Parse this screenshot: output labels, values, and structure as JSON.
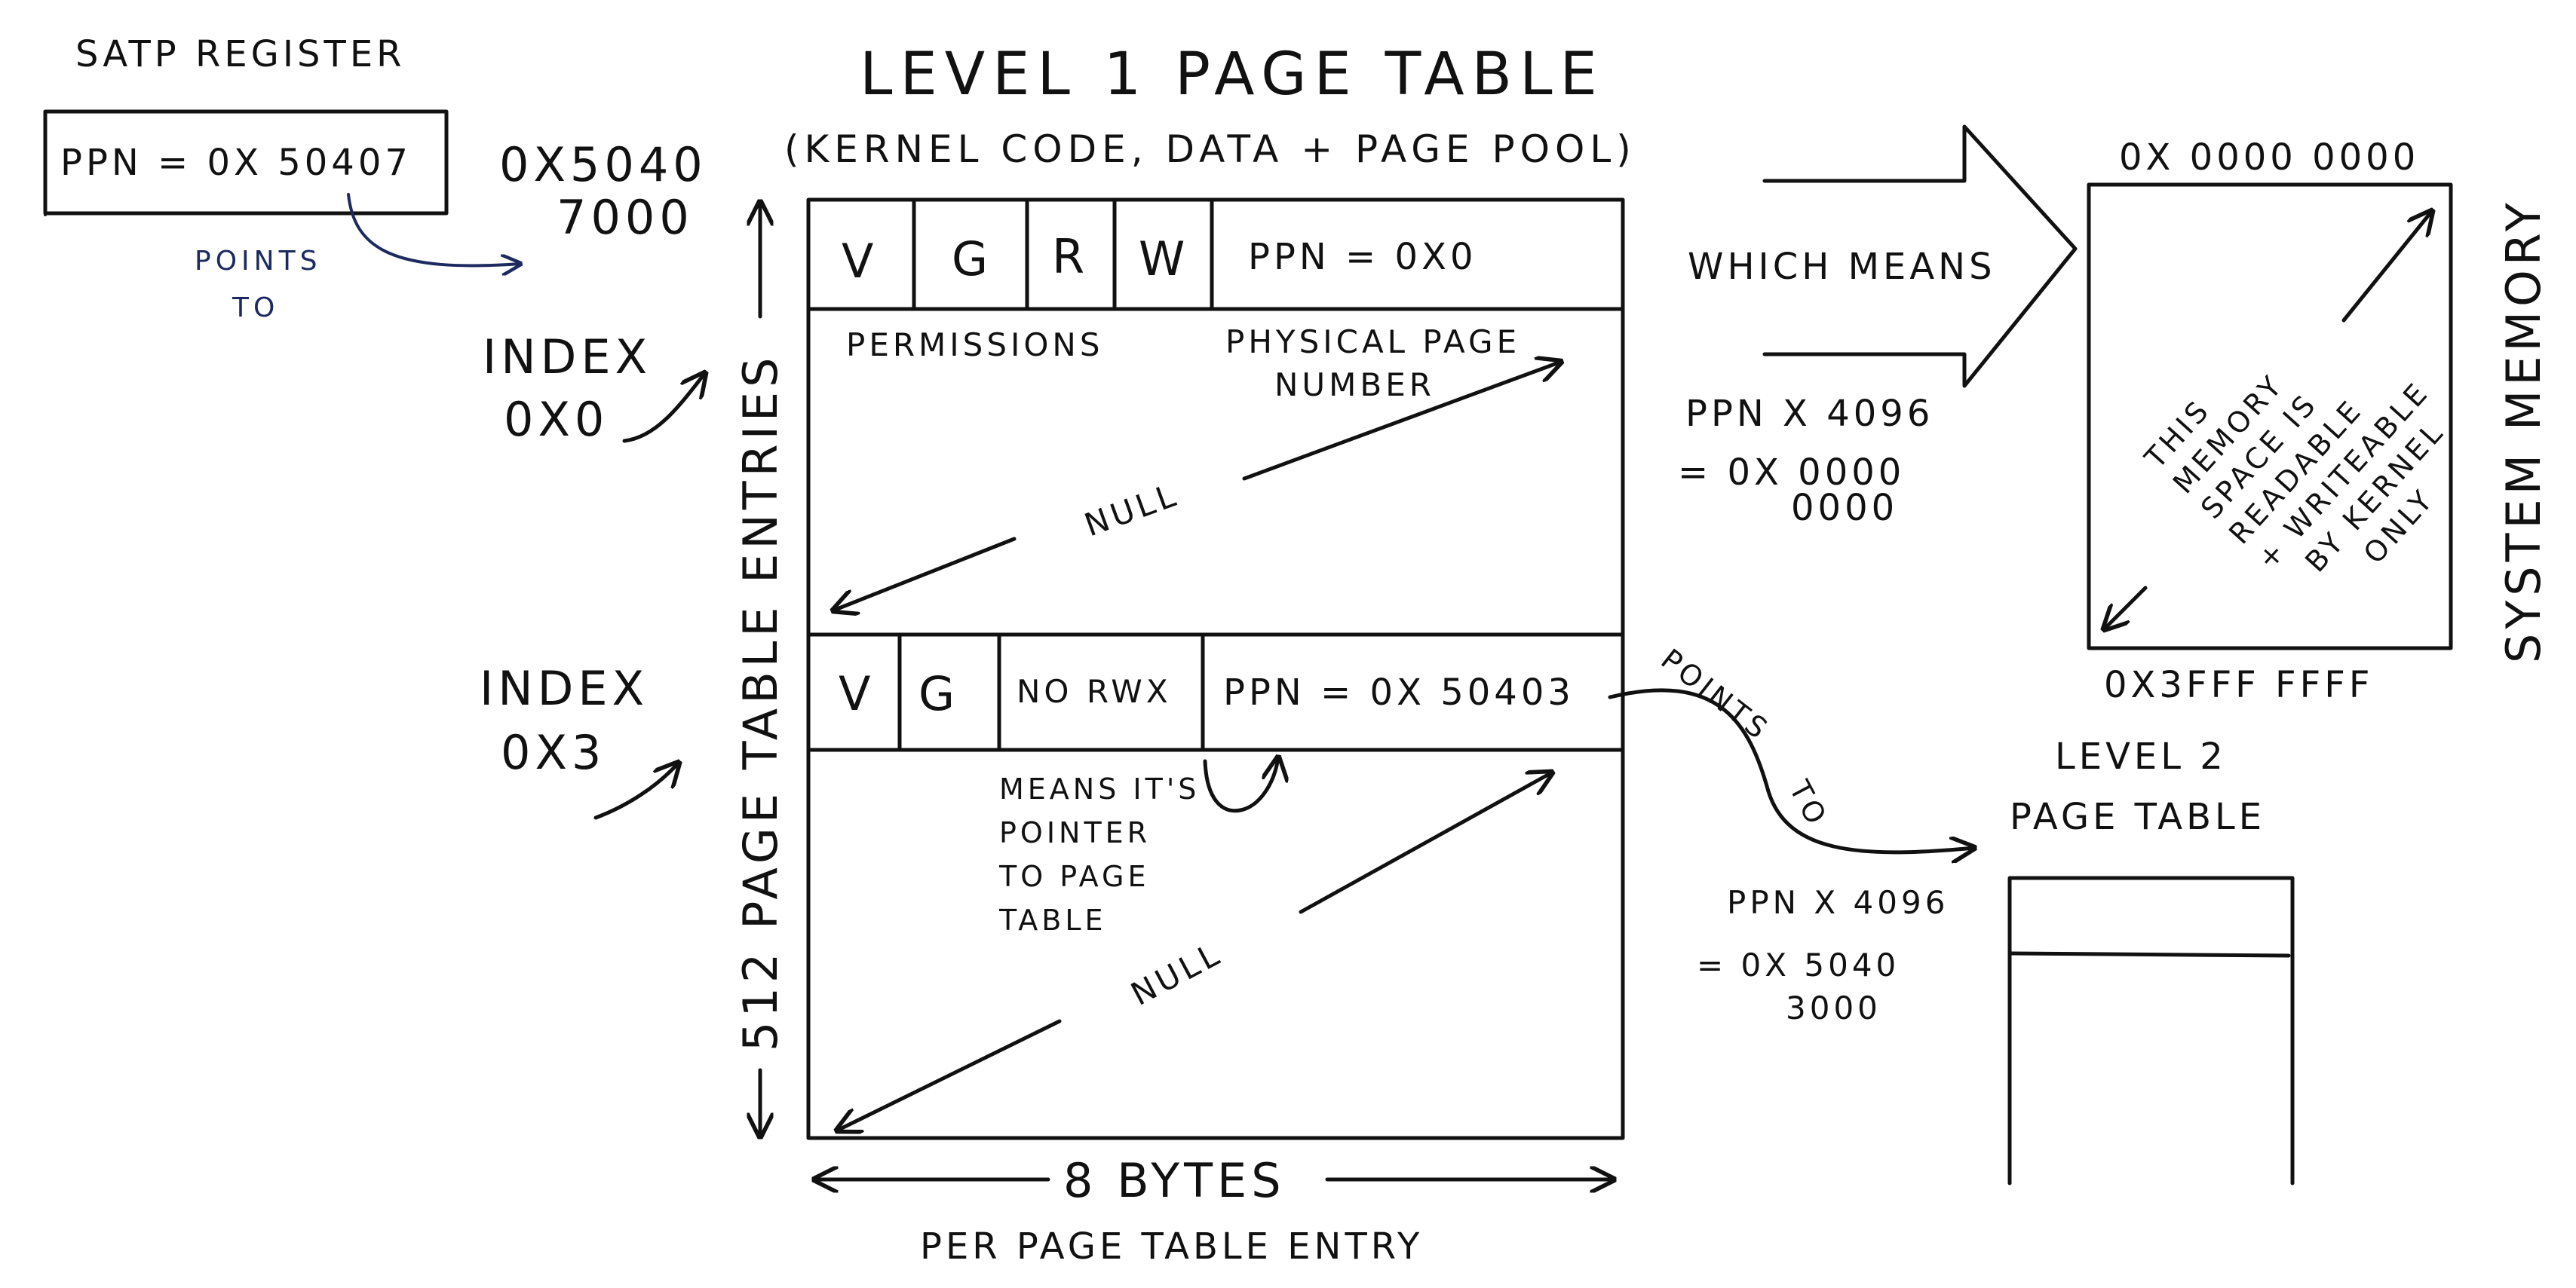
{
  "satp": {
    "title": "SATP Register",
    "value": "PPN = 0x 50407",
    "address_line1": "0x5040",
    "address_line2": "7000",
    "points_to_1": "Points",
    "points_to_2": "to"
  },
  "level1": {
    "title": "Level 1 Page Table",
    "subtitle": "(Kernel Code, Data + Page Pool)"
  },
  "index_0": {
    "line1": "Index",
    "line2": "0x0"
  },
  "index_3": {
    "line1": "Index",
    "line2": "0x3"
  },
  "side_label": "512 Page Table Entries",
  "entry0": {
    "v": "V",
    "g": "G",
    "r": "R",
    "w": "W",
    "ppn": "PPN = 0x0",
    "permissions_label": "Permissions",
    "ppn_label_1": "Physical Page",
    "ppn_label_2": "Number",
    "null": "Null"
  },
  "entry3": {
    "v": "V",
    "g": "G",
    "no_rwx": "No RWX",
    "ppn": "PPN = 0x 50403",
    "means_1": "Means it's",
    "means_2": "pointer",
    "means_3": "to page",
    "means_4": "table",
    "null": "Null",
    "points_to_1": "Points",
    "points_to_2": "to"
  },
  "bytes_label": "8 Bytes",
  "bytes_sub": "per page table entry",
  "which_means": "Which Means",
  "calc1": {
    "line1": "PPN x 4096",
    "line2": "= 0x 0000",
    "line3": "0000"
  },
  "memory": {
    "top_address": "0x 0000 0000",
    "bottom_address": "0x3FFF FFFF",
    "side_label": "System Memory",
    "note": [
      "This",
      "memory",
      "space is",
      "readable",
      "+ writeable",
      "by kernel",
      "only"
    ]
  },
  "level2": {
    "title_1": "Level 2",
    "title_2": "Page Table"
  },
  "calc2": {
    "line1": "PPN x 4096",
    "line2": "= 0x 5040",
    "line3": "3000"
  }
}
